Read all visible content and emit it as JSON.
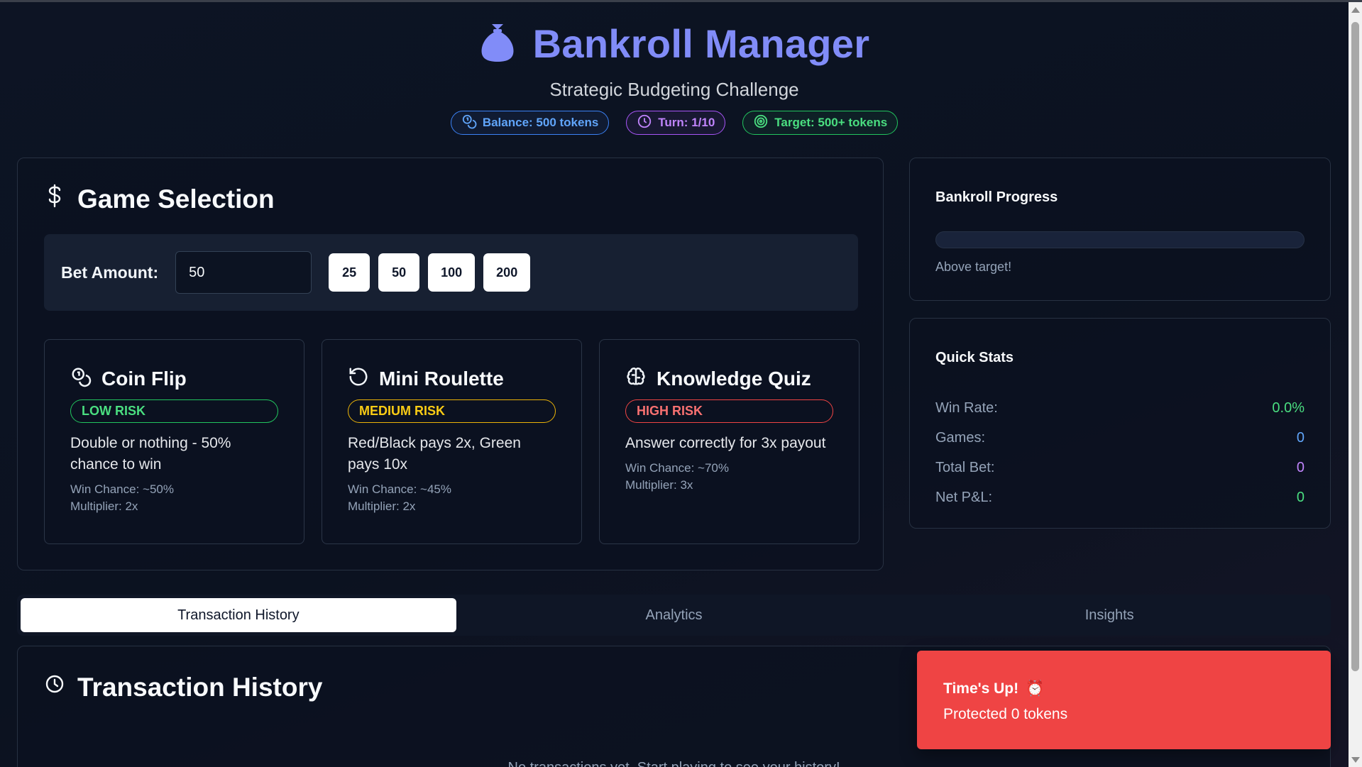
{
  "header": {
    "icon": "money-bag-icon",
    "title": "Bankroll Manager",
    "subtitle": "Strategic Budgeting Challenge",
    "badges": {
      "balance": "Balance: 500 tokens",
      "turn": "Turn: 1/10",
      "target": "Target: 500+ tokens"
    }
  },
  "game_selection": {
    "title": "Game Selection",
    "bet_label": "Bet Amount:",
    "bet_value": "50",
    "chips": [
      "25",
      "50",
      "100",
      "200"
    ],
    "games": [
      {
        "name": "Coin Flip",
        "icon": "coins-icon",
        "risk": "LOW RISK",
        "desc": "Double or nothing - 50% chance to win",
        "win_chance": "Win Chance: ~50%",
        "multiplier": "Multiplier: 2x"
      },
      {
        "name": "Mini Roulette",
        "icon": "rotate-icon",
        "risk": "MEDIUM RISK",
        "desc": "Red/Black pays 2x, Green pays 10x",
        "win_chance": "Win Chance: ~45%",
        "multiplier": "Multiplier: 2x"
      },
      {
        "name": "Knowledge Quiz",
        "icon": "brain-icon",
        "risk": "HIGH RISK",
        "desc": "Answer correctly for 3x payout",
        "win_chance": "Win Chance: ~70%",
        "multiplier": "Multiplier: 3x"
      }
    ]
  },
  "progress": {
    "title": "Bankroll Progress",
    "fill_fraction": 0,
    "note": "Above target!"
  },
  "quick_stats": {
    "title": "Quick Stats",
    "rows": [
      {
        "label": "Win Rate:",
        "value": "0.0%"
      },
      {
        "label": "Games:",
        "value": "0"
      },
      {
        "label": "Total Bet:",
        "value": "0"
      },
      {
        "label": "Net P&L:",
        "value": "0"
      }
    ]
  },
  "tabs": [
    "Transaction History",
    "Analytics",
    "Insights"
  ],
  "history": {
    "title": "Transaction History",
    "empty": "No transactions yet. Start playing to see your history!"
  },
  "toast": {
    "title": "Time's Up!",
    "emoji": "⏰",
    "body": "Protected 0 tokens"
  },
  "colors": {
    "accent": "#818cf8",
    "low_risk": "#22c55e",
    "medium_risk": "#eab308",
    "high_risk": "#ef4444",
    "toast_bg": "#ef4444"
  }
}
